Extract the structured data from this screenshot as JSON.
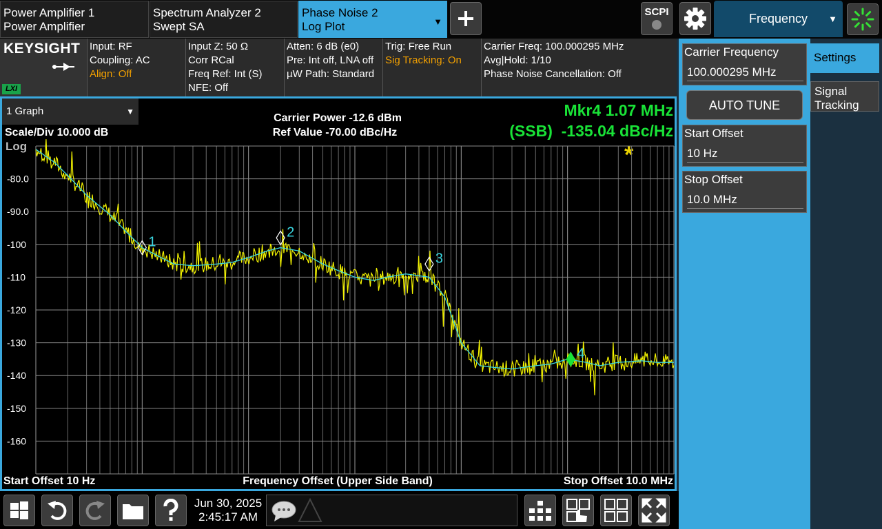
{
  "tabs": [
    {
      "line1": "Power Amplifier 1",
      "line2": "Power Amplifier"
    },
    {
      "line1": "Spectrum Analyzer 2",
      "line2": "Swept SA"
    },
    {
      "line1": "Phase Noise 2",
      "line2": "Log Plot"
    }
  ],
  "topbar": {
    "add_icon": "plus-icon",
    "scpi_label": "SCPI",
    "settings_icon": "gear-icon",
    "menu_label": "Frequency",
    "busy_icon": "spinner-icon"
  },
  "logo": {
    "brand": "KEYSIGHT",
    "lxi": "LXI"
  },
  "info": {
    "col1": [
      "Input: RF",
      "Coupling: AC",
      "Align: Off"
    ],
    "col2": [
      "Input Z: 50 Ω",
      "Corr RCal",
      "Freq Ref: Int (S)",
      "NFE: Off"
    ],
    "col3": [
      "Atten: 6 dB (e0)",
      "Pre: Int off, LNA off",
      "µW Path: Standard"
    ],
    "col4": [
      "Trig: Free Run",
      "Sig Tracking: On"
    ],
    "col5": [
      "Carrier Freq: 100.000295 MHz",
      "Avg|Hold: 1/10",
      "Phase Noise Cancellation: Off"
    ]
  },
  "graph": {
    "selector": "1 Graph",
    "scale": "Scale/Div 10.000 dB",
    "log": "Log",
    "carrier_power": "Carrier Power -12.6 dBm",
    "ref_value": "Ref Value -70.00 dBc/Hz",
    "marker_line1": "Mkr4  1.07 MHz",
    "marker_line2": "(SSB)  -135.04 dBc/Hz",
    "start_offset": "Start Offset 10 Hz",
    "x_title": "Frequency Offset (Upper Side Band)",
    "stop_offset": "Stop Offset 10.0 MHz",
    "star": "*"
  },
  "chart_data": {
    "type": "line",
    "xscale": "log",
    "xlim": [
      10,
      10000000
    ],
    "ylim": [
      -170,
      -70
    ],
    "ytick_labels": [
      "-80.0",
      "-90.0",
      "-100",
      "-110",
      "-120",
      "-130",
      "-140",
      "-150",
      "-160"
    ],
    "grid": true,
    "trace_color": "#f5f500",
    "smoothed_color": "#3ad6e0",
    "series": [
      {
        "x": [
          10,
          15,
          20,
          30,
          50,
          70,
          100,
          150,
          200,
          300,
          500,
          700,
          1000,
          1500,
          2000,
          3000,
          5000,
          7000,
          10000,
          15000,
          20000,
          30000,
          50000,
          70000,
          100000,
          150000,
          200000,
          300000,
          500000,
          700000,
          1000000,
          1500000,
          2000000,
          3000000,
          5000000,
          7000000,
          10000000
        ],
        "y": [
          -71,
          -75,
          -79,
          -85,
          -91,
          -96,
          -101,
          -104,
          -106,
          -106.5,
          -106,
          -105.5,
          -104,
          -102,
          -101,
          -102,
          -106,
          -108,
          -110,
          -111,
          -110,
          -109,
          -110,
          -116,
          -130,
          -137,
          -137.5,
          -138,
          -137,
          -136.5,
          -135,
          -136,
          -137,
          -136,
          -135.5,
          -136,
          -136
        ]
      }
    ],
    "markers": [
      {
        "label": "1",
        "x": 100,
        "y": -101
      },
      {
        "label": "2",
        "x": 2000,
        "y": -98
      },
      {
        "label": "3",
        "x": 50000,
        "y": -106
      },
      {
        "label": "4",
        "x": 1070000,
        "y": -135.04,
        "active": true
      }
    ]
  },
  "panel": {
    "carrier_freq_label": "Carrier Frequency",
    "carrier_freq_value": "100.000295 MHz",
    "auto_tune": "AUTO TUNE",
    "start_offset_label": "Start Offset",
    "start_offset_value": "10 Hz",
    "stop_offset_label": "Stop Offset",
    "stop_offset_value": "10.0 MHz",
    "tab_settings": "Settings",
    "tab_signal_tracking_1": "Signal",
    "tab_signal_tracking_2": "Tracking"
  },
  "bottom": {
    "date": "Jun 30, 2025",
    "time": "2:45:17 AM",
    "icons": [
      "windows-icon",
      "undo-icon",
      "redo-icon",
      "folder-icon",
      "help-icon",
      "message-icon",
      "warning-icon",
      "layout-tree-icon",
      "touch-select-icon",
      "multi-window-icon",
      "fullscreen-icon"
    ]
  }
}
